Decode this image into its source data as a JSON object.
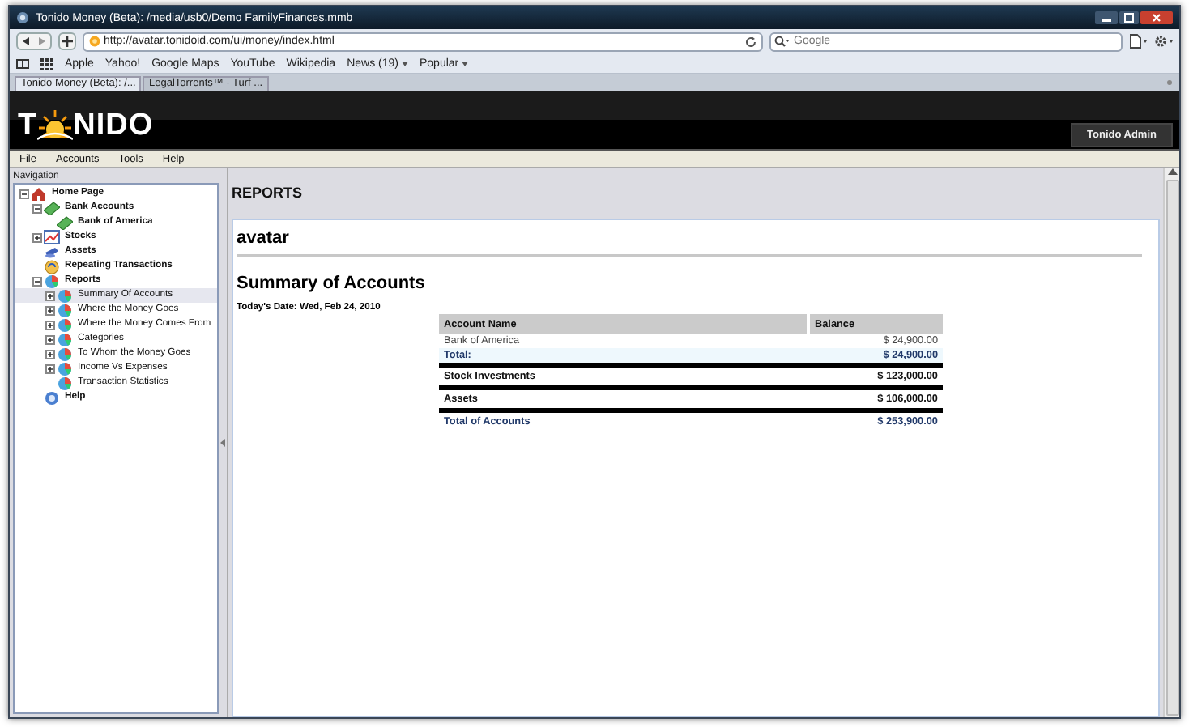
{
  "window": {
    "title": "Tonido Money (Beta): /media/usb0/Demo FamilyFinances.mmb"
  },
  "browser": {
    "url": "http://avatar.tonidoid.com/ui/money/index.html",
    "search": {
      "placeholder": "Google"
    },
    "bookmarks": [
      {
        "label": "Apple",
        "menu": false
      },
      {
        "label": "Yahoo!",
        "menu": false
      },
      {
        "label": "Google Maps",
        "menu": false
      },
      {
        "label": "YouTube",
        "menu": false
      },
      {
        "label": "Wikipedia",
        "menu": false
      },
      {
        "label": "News (19)",
        "menu": true
      },
      {
        "label": "Popular",
        "menu": true
      }
    ],
    "tabs": [
      {
        "label": "Tonido Money (Beta): /...",
        "selected": true
      },
      {
        "label": "LegalTorrents™ - Turf ...",
        "selected": false
      }
    ]
  },
  "app": {
    "logo": [
      "T",
      "NIDO"
    ],
    "user": "Tonido Admin",
    "menu": [
      "File",
      "Accounts",
      "Tools",
      "Help"
    ]
  },
  "navigation": {
    "title": "Navigation",
    "tree": [
      {
        "label": "Home Page",
        "kind": "home",
        "expanded": true,
        "selected": false,
        "children": [
          {
            "label": "Bank Accounts",
            "kind": "bank",
            "expanded": true,
            "selected": false,
            "children": [
              {
                "label": "Bank of America",
                "kind": "bank",
                "selected": false
              }
            ]
          },
          {
            "label": "Stocks",
            "kind": "stocks",
            "expanded": false,
            "selected": false
          },
          {
            "label": "Assets",
            "kind": "assets",
            "selected": false
          },
          {
            "label": "Repeating Transactions",
            "kind": "repeat",
            "selected": false
          },
          {
            "label": "Reports",
            "kind": "reports",
            "expanded": true,
            "selected": false,
            "children": [
              {
                "label": "Summary Of Accounts",
                "kind": "report",
                "expanded": false,
                "selected": true
              },
              {
                "label": "Where the Money Goes",
                "kind": "report",
                "expanded": false,
                "selected": false
              },
              {
                "label": "Where the Money Comes From",
                "kind": "report",
                "expanded": false,
                "selected": false
              },
              {
                "label": "Categories",
                "kind": "report",
                "expanded": false,
                "selected": false
              },
              {
                "label": "To Whom the Money Goes",
                "kind": "report",
                "expanded": false,
                "selected": false
              },
              {
                "label": "Income Vs Expenses",
                "kind": "report",
                "expanded": false,
                "selected": false
              },
              {
                "label": "Transaction Statistics",
                "kind": "report",
                "selected": false
              }
            ]
          },
          {
            "label": "Help",
            "kind": "help",
            "selected": false
          }
        ]
      }
    ]
  },
  "content": {
    "section": "REPORTS",
    "heading": "avatar",
    "report_title": "Summary of Accounts",
    "date": "Today's Date: Wed, Feb 24, 2010",
    "table": {
      "columns": [
        "Account Name",
        "Balance"
      ],
      "rows": [
        {
          "kind": "account",
          "name": "Bank of America",
          "balance": "$ 24,900.00"
        },
        {
          "kind": "subtotal",
          "name": "Total:",
          "balance": "$ 24,900.00"
        },
        {
          "kind": "group",
          "name": "Stock Investments",
          "balance": "$ 123,000.00"
        },
        {
          "kind": "group",
          "name": "Assets",
          "balance": "$ 106,000.00"
        },
        {
          "kind": "grand_total",
          "name": "Total of Accounts",
          "balance": "$ 253,900.00"
        }
      ]
    }
  }
}
